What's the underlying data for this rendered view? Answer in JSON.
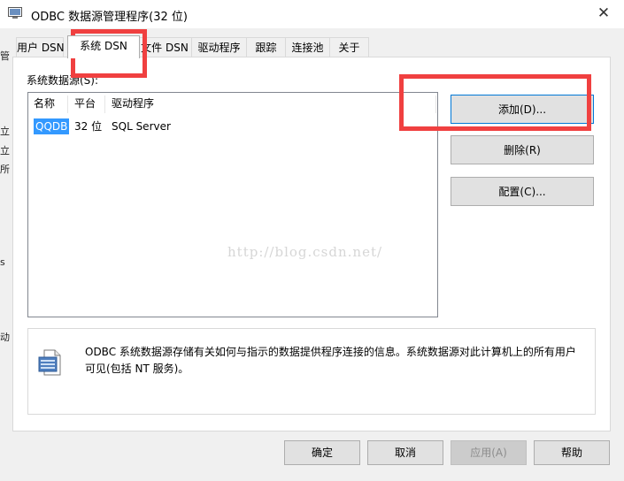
{
  "window": {
    "title": "ODBC 数据源管理程序(32 位)",
    "close_glyph": "✕"
  },
  "left_strip": [
    "管",
    "立",
    "立",
    "所",
    "s",
    "动"
  ],
  "tabs": [
    {
      "label": "用户 DSN"
    },
    {
      "label": "系统 DSN",
      "active": true
    },
    {
      "label": "文件 DSN"
    },
    {
      "label": "驱动程序"
    },
    {
      "label": "跟踪"
    },
    {
      "label": "连接池"
    },
    {
      "label": "关于"
    }
  ],
  "group_label": "系统数据源(S):",
  "list": {
    "columns": [
      "名称",
      "平台",
      "驱动程序"
    ],
    "rows": [
      {
        "name": "QQDB",
        "platform": "32 位",
        "driver": "SQL Server",
        "selected": true
      }
    ]
  },
  "actions": {
    "add": "添加(D)...",
    "remove": "删除(R)",
    "configure": "配置(C)..."
  },
  "info": {
    "icon": "odbc-datasource-icon",
    "text": "ODBC 系统数据源存储有关如何与指示的数据提供程序连接的信息。系统数据源对此计算机上的所有用户可见(包括 NT 服务)。"
  },
  "watermark": "http://blog.csdn.net/",
  "footer": {
    "ok": "确定",
    "cancel": "取消",
    "apply": "应用(A)",
    "help": "帮助"
  },
  "colors": {
    "selection": "#3399ff",
    "annotation": "#f04040",
    "primary_border": "#0078d7"
  }
}
